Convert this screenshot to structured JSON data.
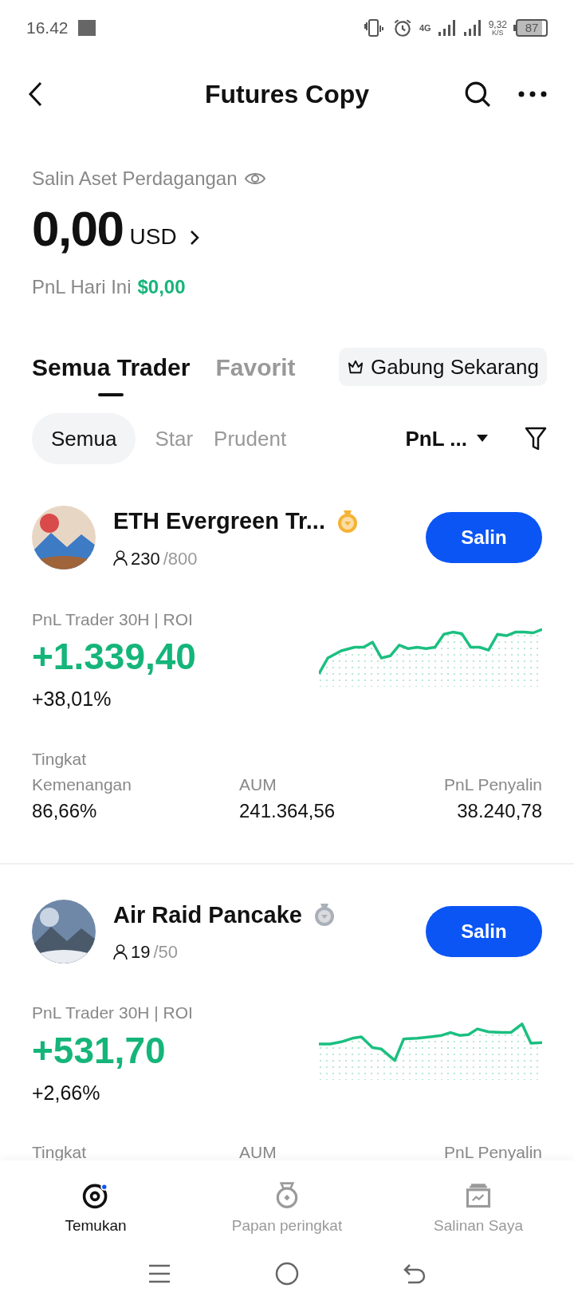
{
  "status_bar": {
    "time": "16.42",
    "network": "4G",
    "speed": "9,32",
    "speed_unit": "K/S",
    "battery": "87"
  },
  "header": {
    "title": "Futures Copy"
  },
  "assets": {
    "label": "Salin Aset Perdagangan",
    "amount": "0,00",
    "currency": "USD",
    "pnl_label": "PnL Hari Ini",
    "pnl_value": "$0,00"
  },
  "tabs": [
    {
      "label": "Semua Trader",
      "selected": true
    },
    {
      "label": "Favorit",
      "selected": false
    }
  ],
  "join_button": "Gabung Sekarang",
  "filters": [
    {
      "label": "Semua",
      "selected": true
    },
    {
      "label": "Star",
      "selected": false
    },
    {
      "label": "Prudent",
      "selected": false
    }
  ],
  "sort": "PnL ...",
  "traders": [
    {
      "name": "ETH Evergreen Tr...",
      "color": "#f5b335",
      "copiers": "230",
      "capacity": "/800",
      "button": "Salin",
      "pnl_label": "PnL Trader 30H | ROI",
      "pnl": "+1.339,40",
      "roi": "+38,01%",
      "win_label": "Tingkat Kemenangan",
      "win": "86,66%",
      "aum_label": "AUM",
      "aum": "241.364,56",
      "copier_pnl_label": "PnL Penyalin",
      "copier_pnl": "38.240,78"
    },
    {
      "name": "Air Raid Pancake",
      "color": "#aab0b8",
      "copiers": "19",
      "capacity": "/50",
      "button": "Salin",
      "pnl_label": "PnL Trader 30H | ROI",
      "pnl": "+531,70",
      "roi": "+2,66%",
      "win_label": "Tingkat",
      "aum_label": "AUM",
      "copier_pnl_label": "PnL Penyalin"
    }
  ],
  "bottom_nav": [
    {
      "kind": "discover",
      "label": "Temukan",
      "selected": true
    },
    {
      "kind": "leaderboard",
      "label": "Papan peringkat",
      "selected": false
    },
    {
      "kind": "copies",
      "label": "Salinan Saya",
      "selected": false
    }
  ]
}
